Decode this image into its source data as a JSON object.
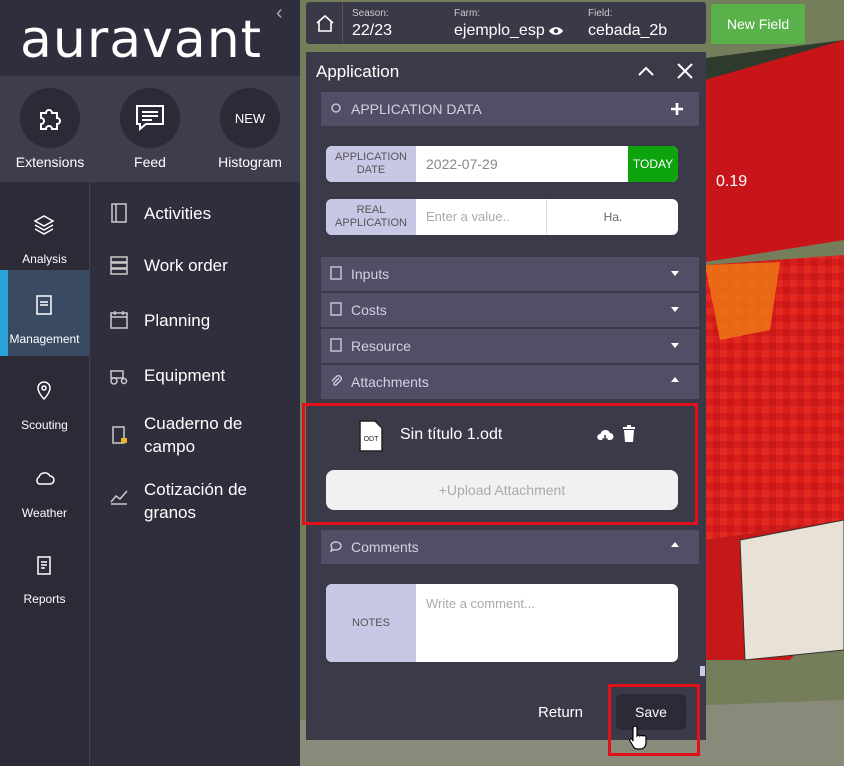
{
  "brand": {
    "logo_text": "auravant"
  },
  "top_actions": [
    {
      "label": "Extensions",
      "icon": "puzzle-icon"
    },
    {
      "label": "Feed",
      "icon": "chat-icon"
    },
    {
      "label": "Histogram",
      "icon": "new-badge",
      "badge": "NEW"
    }
  ],
  "side_nav": [
    {
      "label": "Analysis",
      "icon": "layers-icon"
    },
    {
      "label": "Management",
      "icon": "clipboard-icon",
      "active": true
    },
    {
      "label": "Scouting",
      "icon": "location-pin-icon"
    },
    {
      "label": "Weather",
      "icon": "cloud-icon"
    },
    {
      "label": "Reports",
      "icon": "report-icon"
    }
  ],
  "sub_nav": [
    {
      "label": "Activities",
      "icon": "book-icon"
    },
    {
      "label": "Work order",
      "icon": "server-icon"
    },
    {
      "label": "Planning",
      "icon": "calendar-icon"
    },
    {
      "label": "Equipment",
      "icon": "tractor-icon"
    },
    {
      "label": "Cuaderno de campo",
      "icon": "notebook-icon"
    },
    {
      "label": "Cotización de granos",
      "icon": "chart-icon"
    }
  ],
  "breadcrumb": {
    "season_label": "Season:",
    "season_value": "22/23",
    "farm_label": "Farm:",
    "farm_value": "ejemplo_esp",
    "field_label": "Field:",
    "field_value": "cebada_2b"
  },
  "new_field_button": "New Field",
  "map": {
    "value_label": "0.19"
  },
  "panel": {
    "title": "Application",
    "application_data_section": "APPLICATION DATA",
    "application_date_label": "APPLICATION DATE",
    "application_date_value": "2022-07-29",
    "today_button": "TODAY",
    "real_application_label": "REAL APPLICATION",
    "real_application_placeholder": "Enter a value..",
    "real_application_unit": "Ha.",
    "sections": {
      "inputs": "Inputs",
      "costs": "Costs",
      "resource": "Resource",
      "attachments": "Attachments",
      "comments": "Comments"
    },
    "attachment": {
      "file_type": "ODT",
      "file_name": "Sin título 1.odt"
    },
    "upload_button": "+Upload Attachment",
    "notes_label": "NOTES",
    "notes_placeholder": "Write a comment...",
    "return_button": "Return",
    "save_button": "Save"
  },
  "colors": {
    "accent_green": "#59b14a",
    "today_green": "#0da30d",
    "highlight_red": "#e0111b",
    "map_red": "#d6201a"
  }
}
